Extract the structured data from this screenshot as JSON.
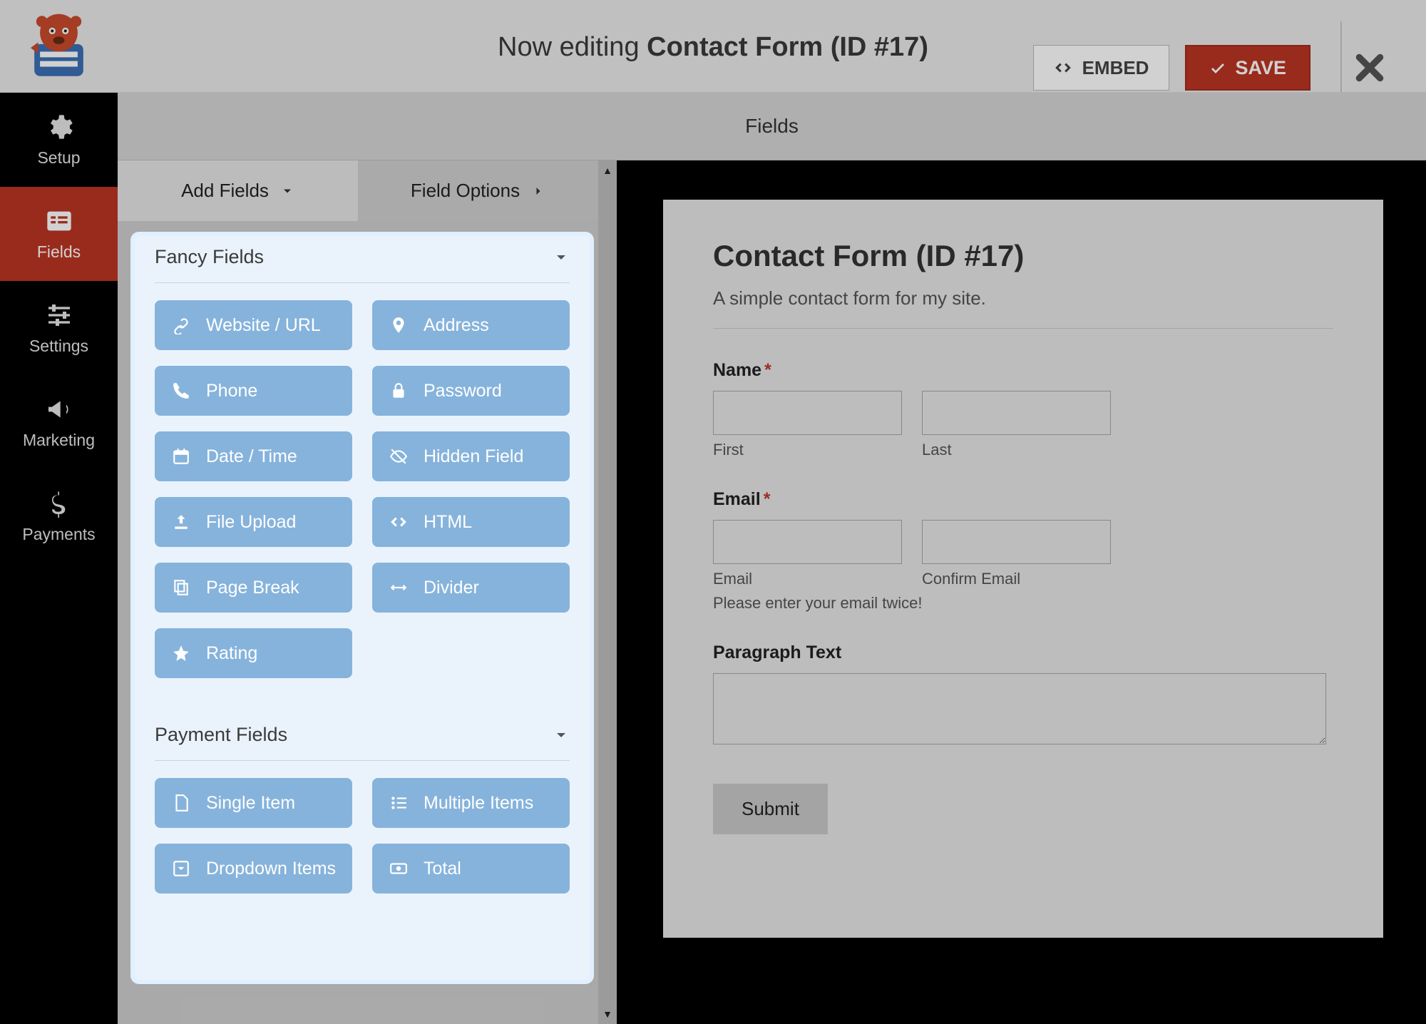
{
  "header": {
    "editing_prefix": "Now editing ",
    "editing_title": "Contact Form (ID #17)",
    "embed_label": "EMBED",
    "save_label": "SAVE"
  },
  "subheader": {
    "title": "Fields"
  },
  "sidebar": {
    "items": [
      {
        "label": "Setup"
      },
      {
        "label": "Fields"
      },
      {
        "label": "Settings"
      },
      {
        "label": "Marketing"
      },
      {
        "label": "Payments"
      }
    ]
  },
  "tabs": {
    "add_fields": "Add Fields",
    "field_options": "Field Options"
  },
  "panel": {
    "fancy_title": "Fancy Fields",
    "payment_title": "Payment Fields",
    "fancy_items": [
      {
        "label": "Website / URL"
      },
      {
        "label": "Address"
      },
      {
        "label": "Phone"
      },
      {
        "label": "Password"
      },
      {
        "label": "Date / Time"
      },
      {
        "label": "Hidden Field"
      },
      {
        "label": "File Upload"
      },
      {
        "label": "HTML"
      },
      {
        "label": "Page Break"
      },
      {
        "label": "Divider"
      },
      {
        "label": "Rating"
      }
    ],
    "payment_items": [
      {
        "label": "Single Item"
      },
      {
        "label": "Multiple Items"
      },
      {
        "label": "Dropdown Items"
      },
      {
        "label": "Total"
      }
    ]
  },
  "preview": {
    "title": "Contact Form (ID #17)",
    "description": "A simple contact form for my site.",
    "fields": {
      "name_label": "Name",
      "name_first": "First",
      "name_last": "Last",
      "email_label": "Email",
      "email_sub1": "Email",
      "email_sub2": "Confirm Email",
      "email_hint": "Please enter your email twice!",
      "paragraph_label": "Paragraph Text",
      "submit_label": "Submit"
    },
    "required_mark": "*"
  }
}
